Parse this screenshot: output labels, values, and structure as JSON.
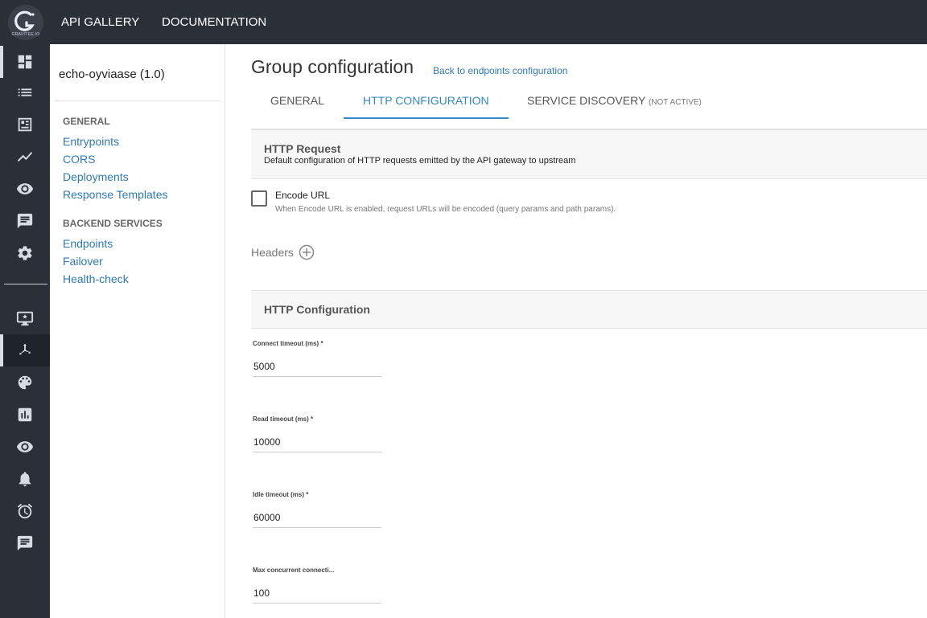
{
  "topbar": {
    "logo_text": "GRAVITEE.IO",
    "nav": [
      "API GALLERY",
      "DOCUMENTATION"
    ]
  },
  "rail": {
    "icons": [
      "dashboard-icon",
      "list-icon",
      "catalog-icon",
      "analytics-icon",
      "eye-icon",
      "message-icon",
      "gear-icon",
      "portal-icon",
      "proxy-icon",
      "palette-icon",
      "bar-chart-icon",
      "eye-icon",
      "bell-icon",
      "alarm-icon",
      "chat-icon"
    ],
    "active_index": 8
  },
  "sidebar": {
    "api_name": "echo-oyviaase (1.0)",
    "general_title": "GENERAL",
    "general_links": [
      "Entrypoints",
      "CORS",
      "Deployments",
      "Response Templates"
    ],
    "backend_title": "BACKEND SERVICES",
    "backend_links": [
      "Endpoints",
      "Failover",
      "Health-check"
    ]
  },
  "main": {
    "title": "Group configuration",
    "back_link": "Back to endpoints configuration",
    "tabs": [
      {
        "label": "GENERAL",
        "suffix": ""
      },
      {
        "label": "HTTP CONFIGURATION",
        "suffix": ""
      },
      {
        "label": "SERVICE DISCOVERY",
        "suffix": "(NOT ACTIVE)"
      }
    ],
    "active_tab": 1,
    "http_request": {
      "title": "HTTP Request",
      "subtitle": "Default configuration of HTTP requests emitted by the API gateway to upstream"
    },
    "encode_url": {
      "label": "Encode URL",
      "hint": "When Encode URL is enabled, request URLs will be encoded (query params and path params).",
      "checked": false
    },
    "headers_label": "Headers",
    "http_config": {
      "title": "HTTP Configuration",
      "fields": [
        {
          "label": "Connect timeout (ms) *",
          "value": "5000"
        },
        {
          "label": "Read timeout (ms) *",
          "value": "10000"
        },
        {
          "label": "Idle timeout (ms) *",
          "value": "60000"
        },
        {
          "label": "Max concurrent connecti...",
          "value": "100"
        }
      ]
    }
  },
  "colors": {
    "accent": "#3389c9",
    "link": "#2e7ab8",
    "rail_bg": "#2b2f38"
  }
}
